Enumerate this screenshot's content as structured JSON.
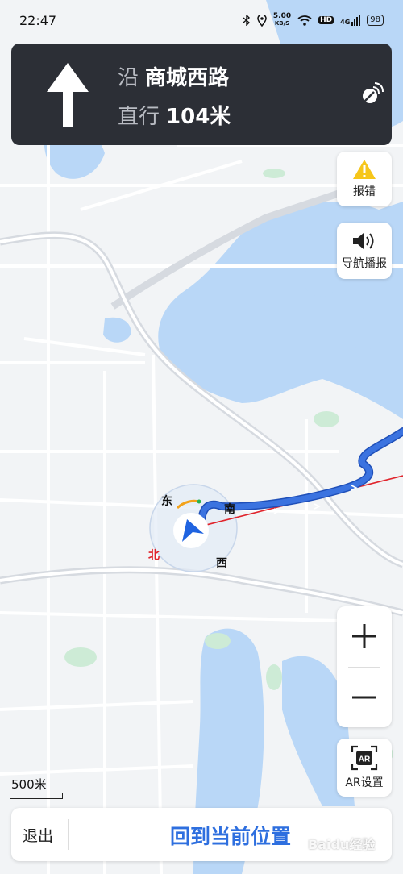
{
  "status_bar": {
    "time": "22:47",
    "net_speed_value": "5.00",
    "net_speed_unit": "KB/S",
    "hd": "HD",
    "signal": "4G",
    "battery": "98",
    "icons": [
      "bluetooth-icon",
      "location-icon",
      "wifi-icon",
      "signal-icon",
      "battery-icon"
    ]
  },
  "guidance": {
    "along_label": "沿",
    "road": "商城西路",
    "action_label": "直行",
    "distance": "104米",
    "arrow_icon": "straight-arrow-icon",
    "gps_icon": "gps-signal-icon"
  },
  "side_buttons": {
    "report": {
      "label": "报错",
      "icon": "warning-icon"
    },
    "voice": {
      "label": "导航播报",
      "icon": "speaker-icon"
    },
    "ar": {
      "label": "AR设置",
      "badge": "AR"
    }
  },
  "zoom": {
    "in_icon": "plus-icon",
    "out_icon": "minus-icon"
  },
  "map": {
    "scale_label": "500米",
    "compass": {
      "east": "东",
      "south": "南",
      "west": "西",
      "north": "北"
    }
  },
  "bottom_bar": {
    "exit_label": "退出",
    "recenter_label": "回到当前位置"
  },
  "watermark": "Baidu经验",
  "colors": {
    "card_bg": "#2c2f36",
    "route": "#3b73e0",
    "water": "#b9d7f7",
    "accent": "#2e6fdf",
    "warning": "#f6c61a"
  }
}
